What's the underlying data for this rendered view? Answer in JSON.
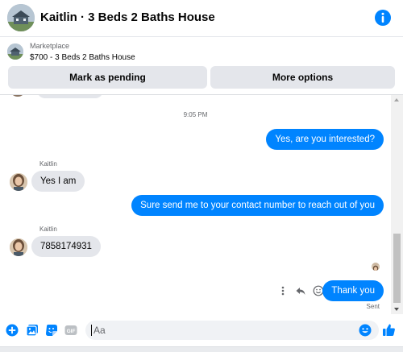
{
  "header": {
    "title": "Kaitlin · 3 Beds 2 Baths House",
    "info_icon": "info-icon"
  },
  "listing": {
    "label": "Marketplace",
    "detail": "$700 - 3 Beds 2 Baths House",
    "mark_pending_label": "Mark as pending",
    "more_options_label": "More options"
  },
  "conversation": {
    "timestamp": "9:05 PM",
    "messages": [
      {
        "direction": "out",
        "text": "Yes, are you interested?"
      },
      {
        "direction": "in",
        "sender": "Kaitlin",
        "text": "Yes I am"
      },
      {
        "direction": "out",
        "text": "Sure send me to your contact number to reach out of you"
      },
      {
        "direction": "in",
        "sender": "Kaitlin",
        "text": "7858174931"
      },
      {
        "direction": "out",
        "text": "Thank you"
      }
    ],
    "status": "Sent"
  },
  "composer": {
    "placeholder": "Aa",
    "icons": [
      "plus-icon",
      "photo-icon",
      "sticker-icon",
      "gif-icon",
      "emoji-icon",
      "thumbs-up-icon"
    ]
  },
  "colors": {
    "accent": "#0084ff",
    "bubble_in": "#e4e6eb",
    "text_secondary": "#65676b"
  }
}
